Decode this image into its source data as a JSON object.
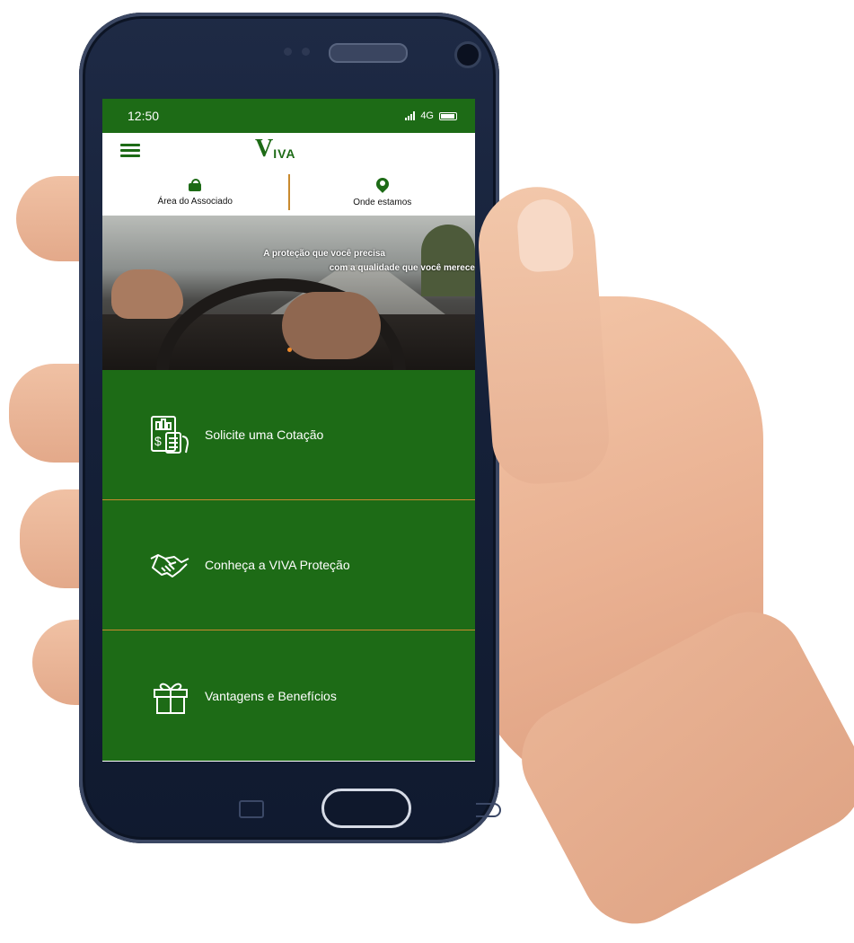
{
  "status_bar": {
    "time": "12:50",
    "network": "4G"
  },
  "header": {
    "logo_mark": "V",
    "logo_text": "IVA"
  },
  "quick_links": [
    {
      "label": "Área do Associado",
      "icon": "lock-icon"
    },
    {
      "label": "Onde estamos",
      "icon": "location-pin-icon"
    }
  ],
  "hero": {
    "line1": "A proteção que você precisa",
    "line2": "com a qualidade que você merece"
  },
  "menu": [
    {
      "label": "Solicite uma Cotação",
      "icon": "quote-calculator-icon"
    },
    {
      "label": "Conheça a VIVA Proteção",
      "icon": "handshake-icon"
    },
    {
      "label": "Vantagens e Benefícios",
      "icon": "gift-icon"
    }
  ],
  "colors": {
    "brand_green": "#1d6b16",
    "divider_gold": "#c98a2e"
  }
}
